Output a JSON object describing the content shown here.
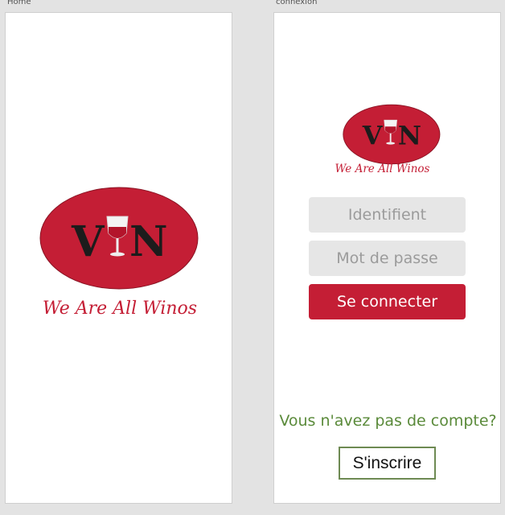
{
  "frames": {
    "home_label": "Home",
    "login_label": "connexion"
  },
  "logo": {
    "letters_left": "V",
    "letters_right": "N",
    "tagline": "We Are All Winos"
  },
  "login": {
    "identifier_placeholder": "Identifient",
    "password_placeholder": "Mot de passe",
    "connect_label": "Se connecter",
    "no_account_text": "Vous n'avez pas de compte?",
    "signup_label": "S'inscrire"
  },
  "colors": {
    "brand_red": "#c41e35",
    "prompt_green": "#5a8a3a",
    "signup_border": "#6e8a53"
  },
  "icons": {
    "logo_glass": "wine-glass-icon"
  }
}
